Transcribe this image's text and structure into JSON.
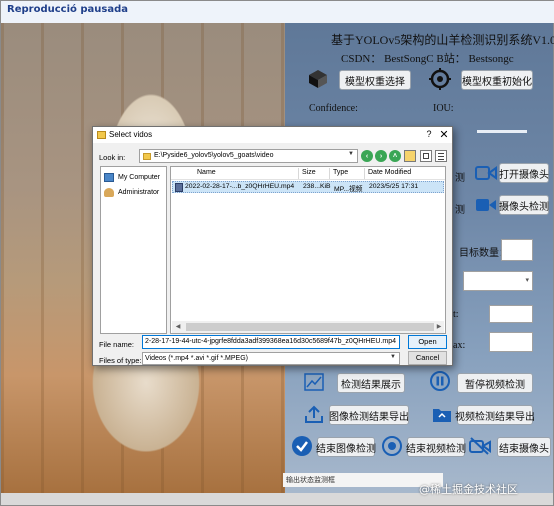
{
  "app": {
    "title": "Reproducció pausada",
    "system_title": "基于YOLOv5架构的山羊检测识别系统V1.0",
    "csdn_line": "CSDN：  BestSongC    B站：  Bestsongc",
    "confidence_label": "Confidence:",
    "iou_label": "IOU:",
    "target_count_label": "目标数量：",
    "status_bar": "输出状态监测框",
    "watermark": "@稀土掘金技术社区",
    "buttons": {
      "model_select": "模型权重选择",
      "model_init": "模型权重初始化",
      "open_camera": "打开摄像头",
      "camera_detect": "摄像头检测",
      "detect_result_show": "检测结果展示",
      "pause_video": "暂停视频检测",
      "export_image_result": "图像检测结果导出",
      "export_video_result": "视频检测结果导出",
      "end_image_detect": "结束图像检测",
      "end_video_detect": "结束视频检测",
      "end_camera": "结束摄像头"
    },
    "partial": {
      "a": "测",
      "b": "测",
      "c": "t:",
      "d": "ax:"
    }
  },
  "dialog": {
    "title": "Select vidos",
    "look_in_label": "Look in:",
    "look_in_value": "E:\\Pyside6_yolov5\\yolov5_goats\\video",
    "sidebar": [
      {
        "label": "My Computer"
      },
      {
        "label": "Administrator"
      }
    ],
    "columns": [
      "Name",
      "Size",
      "Type",
      "Date Modified"
    ],
    "files": [
      {
        "name": "2022-02-28-17-...b_z0QHrHEU.mp4",
        "size": "238...KiB",
        "type": "MP...视频",
        "date": "2023/5/25 17:31"
      }
    ],
    "file_name_label": "File name:",
    "file_name_value": "2-28-17-19-44-utc-4-jpgrfe8fdda3adf399368ea16d30c5689f47b_z0QHrHEU.mp4",
    "file_type_label": "Files of type:",
    "file_type_value": "Videos (*.mp4 *.avi *.gif *.MPEG)",
    "open_label": "Open",
    "cancel_label": "Cancel"
  }
}
